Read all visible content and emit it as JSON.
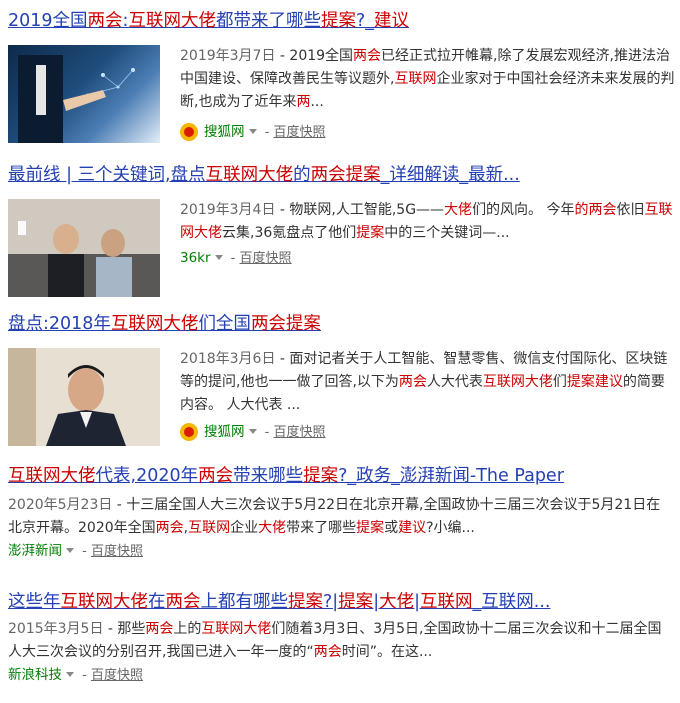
{
  "results": [
    {
      "title_parts": [
        "2019全国",
        "两会",
        ":",
        "互联网大佬",
        "都带来了哪些",
        "提案",
        "?_",
        "建议"
      ],
      "date": "2019年3月7日",
      "abstract_parts": [
        " - 2019全国",
        "两会",
        "已经正式拉开帷幕,除了发展宏观经济,推进法治中国建设、保障改善民生等议题外,",
        "互联网",
        "企业家对于中国社会经济未来发展的判断,也成为了近年来",
        "两",
        "..."
      ],
      "source": "搜狐网",
      "snapshot": "百度快照",
      "thumb_icon": "business-touch-image"
    },
    {
      "title_parts": [
        "最前线 | 三个关键词,盘点",
        "互联网大佬",
        "的",
        "两会提案",
        "_详细解读_最新..."
      ],
      "date": "2019年3月4日",
      "abstract_parts": [
        " - 物联网,人工智能,5G——",
        "大佬",
        "们的风向。 今年",
        "的两会",
        "依旧",
        "互联网大佬",
        "云集,36氪盘点了他们",
        "提案",
        "中的三个关键词—..."
      ],
      "source": "36kr",
      "snapshot": "百度快照",
      "thumb_icon": "meeting-photo"
    },
    {
      "title_parts": [
        "盘点:2018年",
        "互联网大佬",
        "们全国",
        "两会提案"
      ],
      "date": "2018年3月6日",
      "abstract_parts": [
        " - 面对记者关于人工智能、智慧零售、微信支付国际化、区块链等的提问,他也一一做了回答,以下为",
        "两会",
        "人大代表",
        "互联网大佬",
        "们",
        "提案建议",
        "的简要内容。 人大代表 ..."
      ],
      "source": "搜狐网",
      "snapshot": "百度快照",
      "thumb_icon": "portrait-photo"
    },
    {
      "title_parts": [
        "互联网大佬",
        "代表,2020年",
        "两会",
        "带来哪些",
        "提案",
        "?_政务_澎湃新闻-The Paper"
      ],
      "date": "2020年5月23日",
      "abstract_parts": [
        " - 十三届全国人大三次会议于5月22日在北京开幕,全国政协十三届三次会议于5月21日在北京开幕。2020年全国",
        "两会",
        ",",
        "互联网",
        "企业",
        "大佬",
        "带来了哪些",
        "提案",
        "或",
        "建议",
        "?小编..."
      ],
      "source": "澎湃新闻",
      "snapshot": "百度快照"
    },
    {
      "title_parts": [
        "这些年",
        "互联网大佬",
        "在",
        "两会",
        "上都有哪些",
        "提案",
        "?|",
        "提案",
        "|",
        "大佬",
        "|",
        "互联网",
        "_互联网..."
      ],
      "date": "2015年3月5日",
      "abstract_parts": [
        " - 那些",
        "两会",
        "上的",
        "互联网大佬",
        "们随着3月3日、3月5日,全国政协十二届三次会议和十二届全国人大三次会议的分别召开,我国已进入一年一度的“",
        "两会",
        "时间”。在这..."
      ],
      "source": "新浪科技",
      "snapshot": "百度快照"
    }
  ],
  "highlight_color": "#cc0000",
  "link_color": "#2440b3",
  "source_color": "#008000"
}
